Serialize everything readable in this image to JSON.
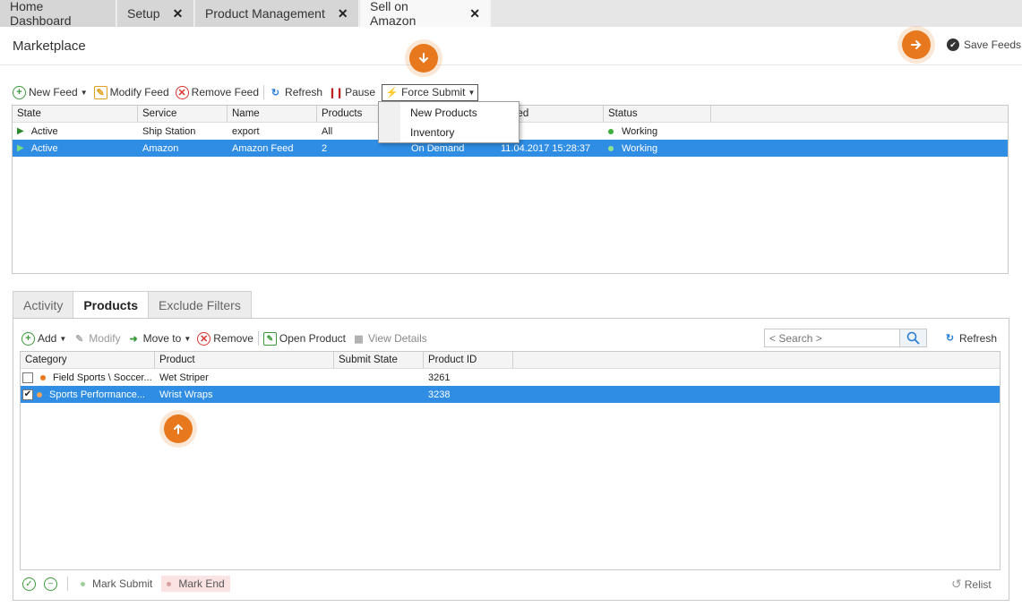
{
  "tabs": [
    {
      "label": "Home Dashboard",
      "closable": false
    },
    {
      "label": "Setup",
      "closable": true
    },
    {
      "label": "Product Management",
      "closable": true
    },
    {
      "label": "Sell on Amazon",
      "closable": true,
      "active": true
    }
  ],
  "close_glyph": "✕",
  "page_title": "Marketplace",
  "save_feeds_label": "Save Feeds",
  "accent_color": "#e8781e",
  "selection_color": "#2f8de4",
  "feeds_toolbar": {
    "new_feed": "New Feed",
    "modify_feed": "Modify Feed",
    "remove_feed": "Remove Feed",
    "refresh": "Refresh",
    "pause": "Pause",
    "force_submit": "Force Submit"
  },
  "force_submit_menu": [
    "New Products",
    "Inventory"
  ],
  "feeds_grid": {
    "columns": [
      "State",
      "Service",
      "Name",
      "Products",
      "",
      "mitted",
      "Status"
    ],
    "rows": [
      {
        "state": "Active",
        "service": "Ship Station",
        "name": "export",
        "products": "All",
        "mode": "",
        "submitted": "",
        "status": "Working",
        "selected": false
      },
      {
        "state": "Active",
        "service": "Amazon",
        "name": "Amazon Feed",
        "products": "2",
        "mode": "On Demand",
        "submitted": "11.04.2017 15:28:37",
        "status": "Working",
        "selected": true
      }
    ]
  },
  "bottom_tabs": [
    {
      "label": "Activity"
    },
    {
      "label": "Products",
      "active": true
    },
    {
      "label": "Exclude Filters"
    }
  ],
  "products_toolbar": {
    "add": "Add",
    "modify": "Modify",
    "move_to": "Move to",
    "remove": "Remove",
    "open_product": "Open Product",
    "view_details": "View Details",
    "refresh": "Refresh"
  },
  "search": {
    "placeholder": "< Search >"
  },
  "products_grid": {
    "columns": [
      "Category",
      "Product",
      "Submit State",
      "Product ID"
    ],
    "rows": [
      {
        "checked": false,
        "category": "Field Sports \\ Soccer...",
        "product": "Wet Striper",
        "submit_state": "",
        "product_id": "3261",
        "selected": false
      },
      {
        "checked": true,
        "category": "Sports Performance...",
        "product": "Wrist Wraps",
        "submit_state": "",
        "product_id": "3238",
        "selected": true
      }
    ]
  },
  "footer": {
    "mark_submit": "Mark Submit",
    "mark_end": "Mark End",
    "relist": "Relist"
  },
  "icons": {
    "badge_down": "down-arrow-icon",
    "badge_right": "right-arrow-icon",
    "badge_up": "up-arrow-icon"
  }
}
